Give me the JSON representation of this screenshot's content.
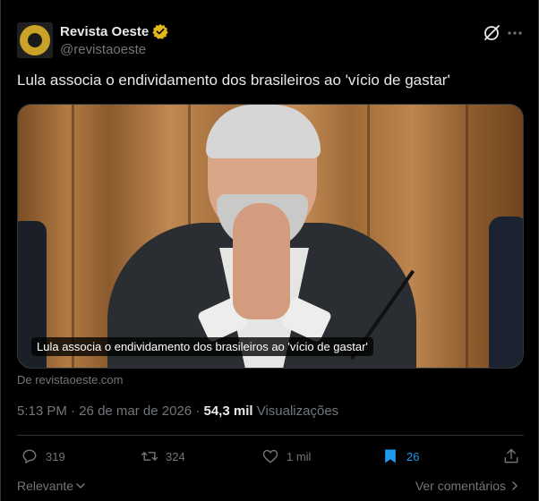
{
  "author": {
    "display_name": "Revista Oeste",
    "handle": "@revistaoeste",
    "verified_color": "#e2b719"
  },
  "tweet": {
    "text": "Lula associa o endividamento dos brasileiros ao 'vício de gastar'"
  },
  "media": {
    "caption": "Lula associa o endividamento dos brasileiros ao 'vício de gastar'",
    "source": "De revistaoeste.com"
  },
  "meta": {
    "time": "5:13 PM",
    "separator": " · ",
    "date": "26 de mar de 2026",
    "views_count": "54,3 mil",
    "views_label": "Visualizações"
  },
  "actions": {
    "replies": "319",
    "reposts": "324",
    "likes": "1 mil",
    "bookmarks": "26"
  },
  "footer": {
    "sort_label": "Relevante",
    "comments_link": "Ver comentários"
  },
  "colors": {
    "background": "#000000",
    "text_primary": "#e7e9ea",
    "text_secondary": "#71767b",
    "accent": "#1d9bf0",
    "border": "#2f3336"
  },
  "icons": {
    "grok": "grok-icon",
    "more": "more-icon",
    "verified": "verified-badge-icon",
    "reply": "reply-icon",
    "repost": "repost-icon",
    "like": "heart-icon",
    "bookmark": "bookmark-icon",
    "share": "share-icon",
    "chevron_down": "chevron-down-icon",
    "chevron_right": "chevron-right-icon"
  }
}
